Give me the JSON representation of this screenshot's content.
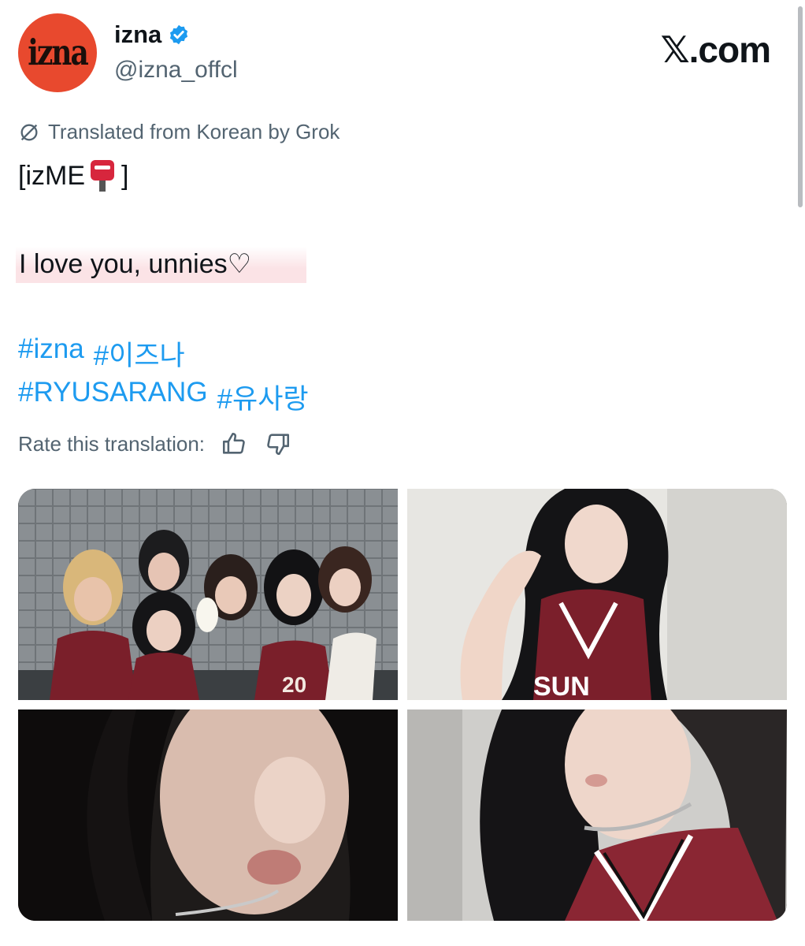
{
  "account": {
    "avatar_text": "izna",
    "display_name": "izna",
    "handle": "@izna_offcl",
    "verified": true
  },
  "site_logo": {
    "x": "𝕏",
    "rest": ".com"
  },
  "post": {
    "translation_notice": "Translated from Korean by Grok",
    "line1_prefix": "[izME",
    "line1_emoji": "mailbox-icon",
    "line1_suffix": "]",
    "line2": "I love you, unnies♡",
    "hashtags_row1": [
      "#izna",
      "#이즈나"
    ],
    "hashtags_row2": [
      "#RYUSARANG",
      "#유사랑"
    ],
    "rate_label": "Rate this translation:"
  },
  "colors": {
    "avatar_bg": "#e8492e",
    "hashtag": "#1d9bf0",
    "muted": "#536471",
    "highlight": "#fbe3e6"
  },
  "media": {
    "count": 4,
    "items": [
      "group-selfie-photo",
      "heart-pose-photo",
      "closeup-pout-photo",
      "closeup-jersey-photo"
    ]
  }
}
